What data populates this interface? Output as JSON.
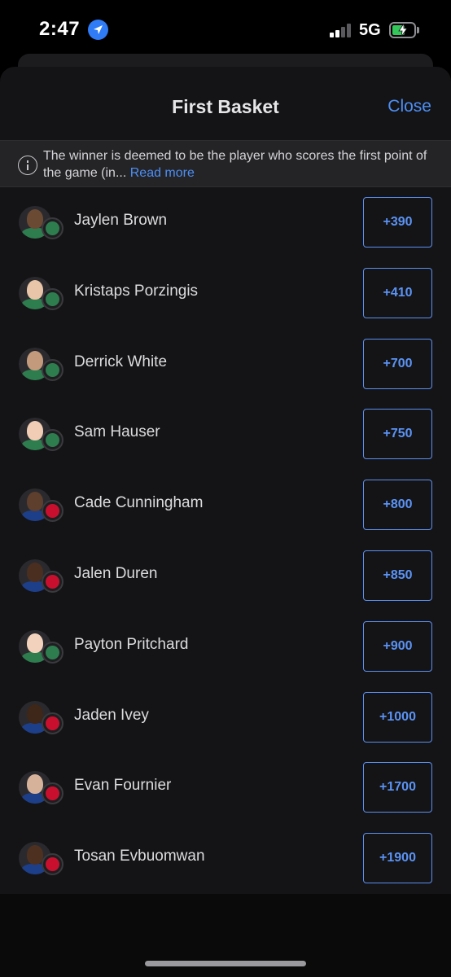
{
  "status_bar": {
    "time": "2:47",
    "network": "5G"
  },
  "sheet": {
    "title": "First Basket",
    "close_label": "Close"
  },
  "info": {
    "text": "The winner is deemed to be the player who scores the first point of the game (in...",
    "read_more": "Read more"
  },
  "players": [
    {
      "name": "Jaylen Brown",
      "odds": "+390",
      "team": "celtics"
    },
    {
      "name": "Kristaps Porzingis",
      "odds": "+410",
      "team": "celtics"
    },
    {
      "name": "Derrick White",
      "odds": "+700",
      "team": "celtics"
    },
    {
      "name": "Sam Hauser",
      "odds": "+750",
      "team": "celtics"
    },
    {
      "name": "Cade Cunningham",
      "odds": "+800",
      "team": "pistons"
    },
    {
      "name": "Jalen Duren",
      "odds": "+850",
      "team": "pistons"
    },
    {
      "name": "Payton Pritchard",
      "odds": "+900",
      "team": "celtics"
    },
    {
      "name": "Jaden Ivey",
      "odds": "+1000",
      "team": "pistons"
    },
    {
      "name": "Evan Fournier",
      "odds": "+1700",
      "team": "pistons"
    },
    {
      "name": "Tosan Evbuomwan",
      "odds": "+1900",
      "team": "pistons"
    }
  ],
  "colors": {
    "accent": "#4d8ff5",
    "celtics": "#2e7d4f",
    "pistons": "#c8102e",
    "battery": "#34c759"
  }
}
